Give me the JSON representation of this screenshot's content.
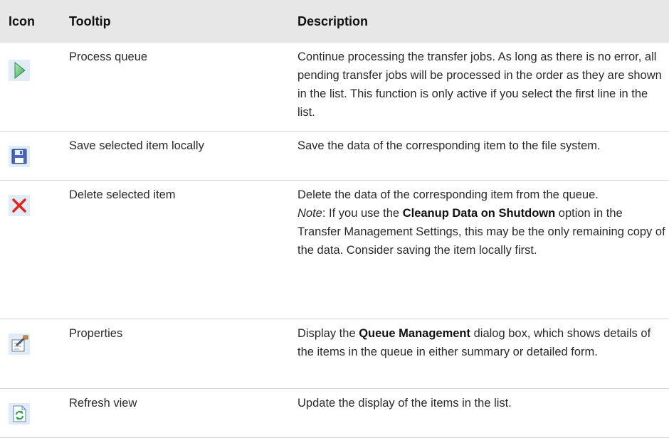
{
  "headers": {
    "icon": "Icon",
    "tooltip": "Tooltip",
    "description": "Description"
  },
  "rows": [
    {
      "icon": "play-icon",
      "tooltip": "Process queue",
      "description": "Continue processing the transfer jobs. As long as there is no error, all pending transfer jobs will be processed in the order as they are shown in the list. This function is only active if you select the first line in the list."
    },
    {
      "icon": "floppy-disk-icon",
      "tooltip": "Save selected item locally",
      "description": "Save the data of the corresponding item to the file system."
    },
    {
      "icon": "delete-x-icon",
      "tooltip": "Delete selected item",
      "description": "Delete the data of the corresponding item from the queue.",
      "note_label": "Note",
      "note_pre": ": If you use the ",
      "note_bold": "Cleanup Data on Shutdown",
      "note_post": " option in the Transfer Management Settings, this may be the only remaining copy of the data. Consider saving the item locally first."
    },
    {
      "icon": "properties-icon",
      "tooltip": "Properties",
      "desc_pre": "Display the ",
      "desc_bold": "Queue Management",
      "desc_post": " dialog box, which shows details of the items in the queue in either summary or detailed form."
    },
    {
      "icon": "refresh-icon",
      "tooltip": "Refresh view",
      "description": "Update the display of the items in the list."
    }
  ]
}
